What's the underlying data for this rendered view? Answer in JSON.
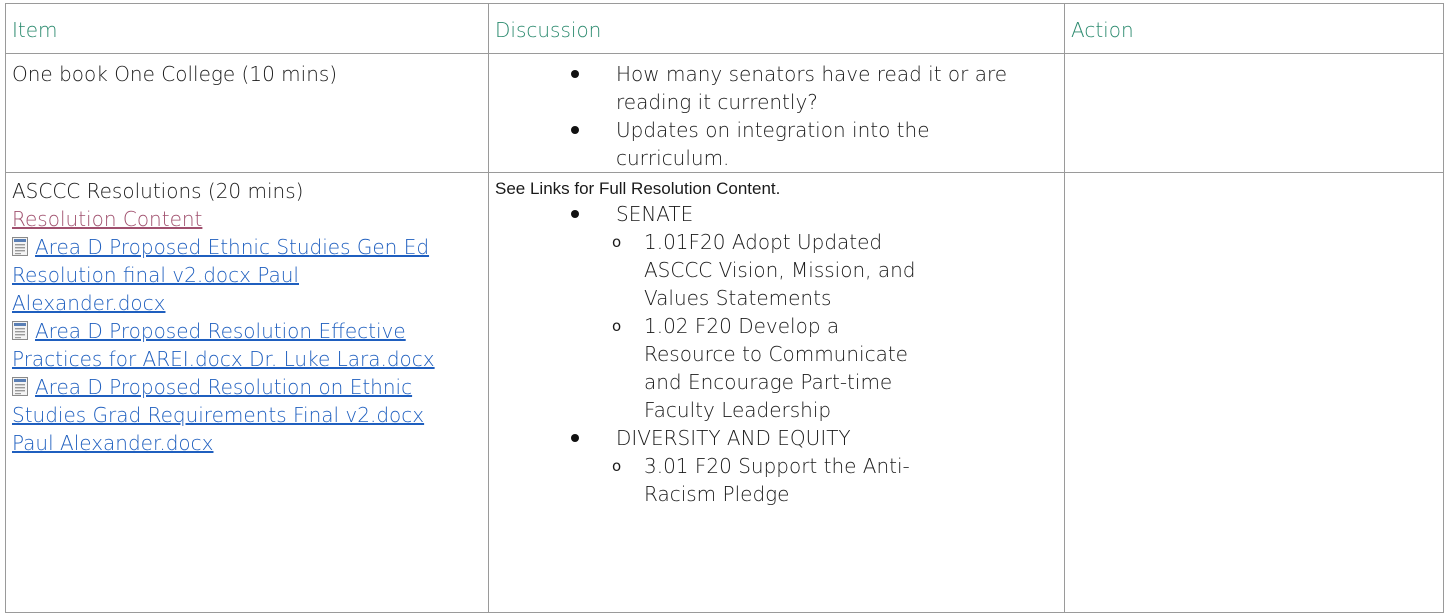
{
  "header": {
    "item": "Item",
    "discussion": "Discussion",
    "action": "Action"
  },
  "rows": [
    {
      "item": "One book One College (10 mins)",
      "discussion": [
        "How many senators have read it or are reading it currently?",
        "Updates on integration into the curriculum."
      ],
      "action": ""
    },
    {
      "item": "ASCCC Resolutions (20 mins)",
      "item_link": "Resolution Content",
      "documents": [
        "Area D Proposed Ethnic Studies Gen Ed Resolution final v2.docx Paul Alexander.docx",
        "Area D Proposed Resolution Effective Practices for AREI.docx Dr. Luke Lara.docx",
        "Area D Proposed Resolution on Ethnic Studies Grad Requirements Final v2.docx Paul Alexander.docx"
      ],
      "note": "See Links for Full Resolution Content.",
      "groups": [
        {
          "name": "SENATE",
          "items": [
            "1.01F20 Adopt Updated ASCCC Vision, Mission, and Values Statements",
            "1.02 F20 Develop a Resource to Communicate and Encourage Part-time Faculty Leadership"
          ]
        },
        {
          "name": "DIVERSITY AND EQUITY",
          "items": [
            "3.01 F20 Support the Anti-Racism Pledge"
          ]
        }
      ],
      "action": ""
    }
  ],
  "icons": {
    "document": "word-document-icon"
  },
  "colors": {
    "header_text": "#2b8a6e",
    "link": "#1f5fbf",
    "visited_link": "#a0506e",
    "border": "#9a9a9a"
  }
}
